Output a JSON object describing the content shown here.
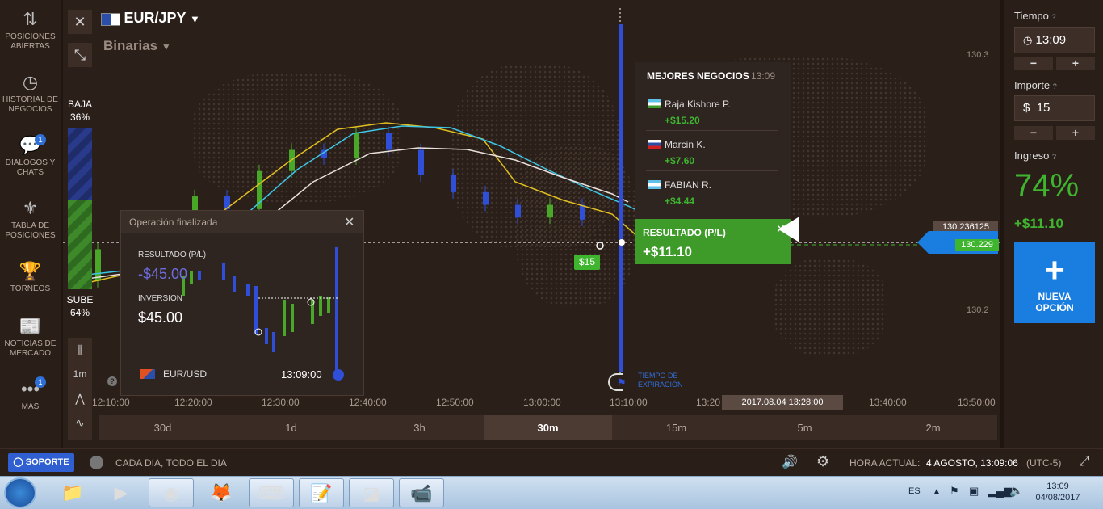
{
  "sidebar": {
    "items": [
      {
        "label_1": "POSICIONES",
        "label_2": "ABIERTAS",
        "icon": "arrows-updown-icon"
      },
      {
        "label_1": "HISTORIAL DE",
        "label_2": "NEGOCIOS",
        "icon": "history-icon"
      },
      {
        "label_1": "DIALOGOS Y",
        "label_2": "CHATS",
        "icon": "chat-icon",
        "badge": "1"
      },
      {
        "label_1": "TABLA DE",
        "label_2": "POSICIONES",
        "icon": "medal-icon"
      },
      {
        "label_1": "TORNEOS",
        "label_2": "",
        "icon": "trophy-icon"
      },
      {
        "label_1": "NOTICIAS DE",
        "label_2": "MERCADO",
        "icon": "news-icon"
      },
      {
        "label_1": "MAS",
        "label_2": "",
        "icon": "more-icon",
        "badge": "1"
      }
    ]
  },
  "header": {
    "pair": "EUR/JPY",
    "mode": "Binarias"
  },
  "sentiment": {
    "baja_label": "BAJA",
    "baja_pct": "36%",
    "sube_label": "SUBE",
    "sube_pct": "64%"
  },
  "tools": {
    "interval": "1m",
    "help": "?"
  },
  "chart": {
    "price_top": "130.3",
    "price_bottom": "130.2",
    "current_price": "130.236125",
    "strike_price": "130.229",
    "bet_tag": "$15",
    "expiry_label_1": "TIEMPO DE",
    "expiry_label_2": "EXPIRACIÓN",
    "time_labels": [
      "12:10:00",
      "12:20:00",
      "12:30:00",
      "12:40:00",
      "12:50:00",
      "13:00:00",
      "13:10:00",
      "13:20",
      "13:40:00",
      "13:50:00"
    ],
    "cursor_date": "2017.08.04 13:28:00",
    "timeframes": [
      "30d",
      "1d",
      "3h",
      "30m",
      "15m",
      "5m",
      "2m"
    ],
    "active_timeframe": "30m",
    "candles": [
      {
        "o": 130.2,
        "c": 130.215,
        "up": true
      },
      {
        "o": 130.215,
        "c": 130.205,
        "up": false
      },
      {
        "o": 130.205,
        "c": 130.228,
        "up": true
      },
      {
        "o": 130.228,
        "c": 130.24,
        "up": true
      },
      {
        "o": 130.24,
        "c": 130.234,
        "up": false
      },
      {
        "o": 130.234,
        "c": 130.252,
        "up": true
      },
      {
        "o": 130.252,
        "c": 130.262,
        "up": true
      },
      {
        "o": 130.262,
        "c": 130.258,
        "up": false
      },
      {
        "o": 130.258,
        "c": 130.27,
        "up": true
      },
      {
        "o": 130.27,
        "c": 130.262,
        "up": false
      },
      {
        "o": 130.262,
        "c": 130.25,
        "up": false
      },
      {
        "o": 130.25,
        "c": 130.242,
        "up": false
      },
      {
        "o": 130.242,
        "c": 130.236,
        "up": false
      },
      {
        "o": 130.236,
        "c": 130.23,
        "up": false
      },
      {
        "o": 130.23,
        "c": 130.236,
        "up": true
      },
      {
        "o": 130.236,
        "c": 130.229,
        "up": false
      }
    ]
  },
  "op_finalizada": {
    "title": "Operación finalizada",
    "resultado_label": "RESULTADO (P/L)",
    "resultado_value": "-$45.00",
    "inversion_label": "INVERSION",
    "inversion_value": "$45.00",
    "pair": "EUR/USD",
    "time": "13:09:00"
  },
  "mejores": {
    "title": "MEJORES NEGOCIOS",
    "time": "13:09",
    "traders": [
      {
        "name": "Raja Kishore P.",
        "profit": "+$15.20"
      },
      {
        "name": "Marcin K.",
        "profit": "+$7.60"
      },
      {
        "name": "FABIAN R.",
        "profit": "+$4.44"
      }
    ]
  },
  "resultado": {
    "label": "RESULTADO (P/L)",
    "value": "+$11.10"
  },
  "right_panel": {
    "tiempo_label": "Tiempo",
    "tiempo_value": "13:09",
    "importe_label": "Importe",
    "importe_currency": "$",
    "importe_value": "15",
    "ingreso_label": "Ingreso",
    "ingreso_pct": "74%",
    "ingreso_value": "+$11.10",
    "minus": "−",
    "plus": "+",
    "nueva_1": "NUEVA",
    "nueva_2": "OPCIÓN"
  },
  "status": {
    "soporte": "SOPORTE",
    "schedule": "CADA DIA, TODO EL DIA",
    "hora_label": "HORA ACTUAL:",
    "hora_value": "4 AGOSTO, 13:09:06",
    "tz": "(UTC-5)"
  },
  "taskbar": {
    "lang": "ES",
    "clock_time": "13:09",
    "clock_date": "04/08/2017"
  },
  "colors": {
    "up": "#4aa829",
    "down": "#2f4fd8",
    "accent_blue": "#1a7de0",
    "profit_green": "#3fb52f",
    "loss": "#6d6de0"
  }
}
